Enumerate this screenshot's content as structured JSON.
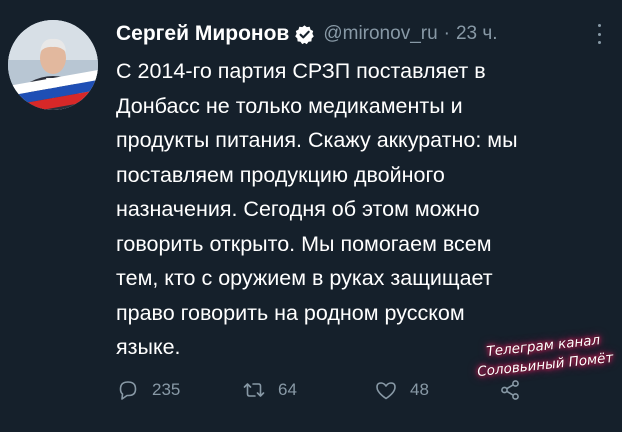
{
  "tweet": {
    "author_name": "Сергей Миронов",
    "verified_icon": "verified-badge-icon",
    "handle": "@mironov_ru",
    "separator": "·",
    "time": "23 ч.",
    "text_lines": [
      "С 2014-го партия СРЗП поставляет в",
      "Донбасс не только медикаменты и",
      "продукты питания. Скажу аккуратно: мы",
      "поставляем продукцию двойного",
      "назначения. Сегодня об этом можно",
      "говорить открыто. Мы помогаем всем",
      "тем, кто с оружием в руках защищает",
      "право говорить на родном русском",
      "языке."
    ]
  },
  "actions": {
    "replies": "235",
    "retweets": "64",
    "likes": "48"
  },
  "watermark": {
    "line1": "Телеграм канал",
    "line2": "Соловьиный Помёт"
  },
  "colors": {
    "background": "#15202b",
    "text": "#ffffff",
    "secondary": "#8899a6",
    "verified_badge": "#ffffff"
  }
}
